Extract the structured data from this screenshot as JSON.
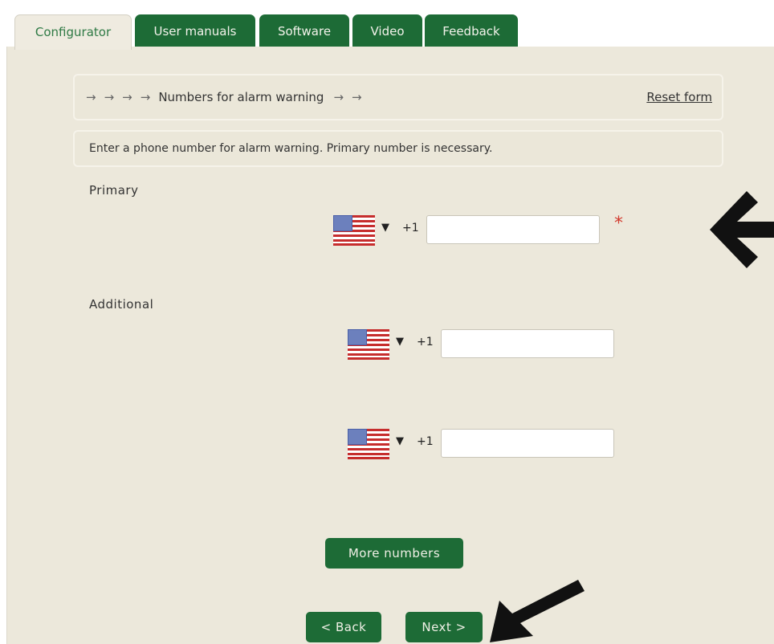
{
  "tabs": [
    {
      "label": "Configurator",
      "active": true
    },
    {
      "label": "User manuals",
      "active": false
    },
    {
      "label": "Software",
      "active": false
    },
    {
      "label": "Video",
      "active": false
    },
    {
      "label": "Feedback",
      "active": false
    }
  ],
  "progress": {
    "arrows_before": [
      "→",
      "→",
      "→",
      "→"
    ],
    "current_step": "Numbers for alarm warning",
    "arrows_after": [
      "→",
      "→"
    ],
    "reset_label": "Reset form"
  },
  "info_text": "Enter a phone number for alarm warning. Primary number is necessary.",
  "primary": {
    "label": "Primary",
    "country_flag": "us-flag-icon",
    "dial_code": "+1",
    "value": "",
    "required_mark": "*"
  },
  "additional": {
    "label": "Additional",
    "numbers": [
      {
        "country_flag": "us-flag-icon",
        "dial_code": "+1",
        "value": ""
      },
      {
        "country_flag": "us-flag-icon",
        "dial_code": "+1",
        "value": ""
      }
    ]
  },
  "buttons": {
    "more_numbers": "More numbers",
    "back": "< Back",
    "next": "Next >"
  },
  "colors": {
    "accent_green": "#1d6b36",
    "panel_bg": "#ece8db",
    "required_red": "#d23a2e"
  }
}
